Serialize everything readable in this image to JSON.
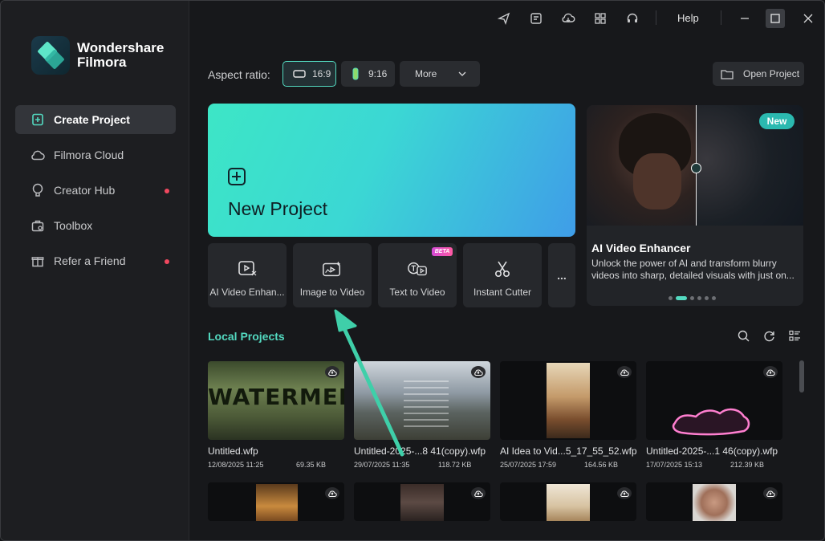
{
  "app": {
    "brand_line1": "Wondershare",
    "brand_line2": "Filmora"
  },
  "sidebar": {
    "items": [
      {
        "label": "Create Project",
        "icon": "plus-square-icon",
        "active": true,
        "dot": false
      },
      {
        "label": "Filmora Cloud",
        "icon": "cloud-icon",
        "active": false,
        "dot": false
      },
      {
        "label": "Creator Hub",
        "icon": "lightbulb-icon",
        "active": false,
        "dot": true
      },
      {
        "label": "Toolbox",
        "icon": "toolbox-icon",
        "active": false,
        "dot": false
      },
      {
        "label": "Refer a Friend",
        "icon": "gift-icon",
        "active": false,
        "dot": true
      }
    ]
  },
  "titlebar": {
    "help_label": "Help",
    "icons": [
      "send-icon",
      "notes-icon",
      "cloud-download-icon",
      "grid-icon",
      "headset-icon"
    ]
  },
  "aspect": {
    "label": "Aspect ratio:",
    "ratio_169": "16:9",
    "ratio_916": "9:16",
    "more_label": "More",
    "open_project": "Open Project"
  },
  "new_project": {
    "label": "New Project"
  },
  "tools": [
    {
      "label": "AI Video Enhan...",
      "icon": "ai-video-enhancer-icon"
    },
    {
      "label": "Image to Video",
      "icon": "image-to-video-icon"
    },
    {
      "label": "Text to Video",
      "icon": "text-to-video-icon",
      "badge": "BETA"
    },
    {
      "label": "Instant Cutter",
      "icon": "scissors-icon"
    }
  ],
  "tools_more": "...",
  "promo": {
    "badge": "New",
    "title": "AI Video Enhancer",
    "description": "Unlock the power of AI and transform blurry videos into sharp, detailed visuals with just on..."
  },
  "local_projects": {
    "title": "Local Projects",
    "projects": [
      {
        "name": "Untitled.wfp",
        "date": "12/08/2025 11:25",
        "size": "69.35 KB",
        "thumb_text": "WATERMELON"
      },
      {
        "name": "Untitled-2025-...8 41(copy).wfp",
        "date": "29/07/2025 11:35",
        "size": "118.72 KB"
      },
      {
        "name": "AI Idea to Vid...5_17_55_52.wfp",
        "date": "25/07/2025 17:59",
        "size": "164.56 KB"
      },
      {
        "name": "Untitled-2025-...1 46(copy).wfp",
        "date": "17/07/2025 15:13",
        "size": "212.39 KB"
      }
    ]
  },
  "colors": {
    "accent": "#53d9c0",
    "notification_dot": "#f0485f",
    "annotation_arrow": "#3fcfa9"
  }
}
